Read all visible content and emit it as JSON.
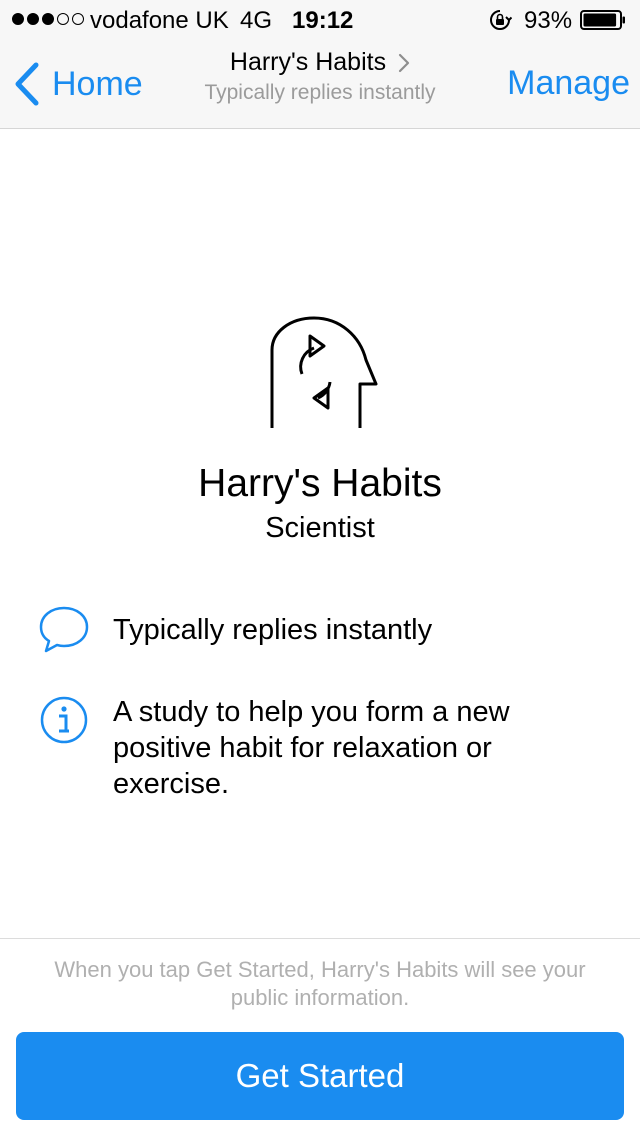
{
  "status_bar": {
    "signal_filled": 3,
    "signal_total": 5,
    "carrier": "vodafone UK",
    "network": "4G",
    "time": "19:12",
    "battery_percent": "93%",
    "battery_level": 0.93
  },
  "nav": {
    "back_label": "Home",
    "title": "Harry's Habits",
    "subtitle": "Typically replies instantly",
    "manage_label": "Manage"
  },
  "profile": {
    "icon": "head-refresh-icon",
    "name": "Harry's Habits",
    "role": "Scientist"
  },
  "info": {
    "replies": "Typically replies instantly",
    "about": "A study to help you form a new positive habit for relaxation or exercise."
  },
  "footer": {
    "disclaimer": "When you tap Get Started, Harry's Habits will see your public information.",
    "button_label": "Get Started"
  },
  "colors": {
    "accent": "#1a8cf0",
    "muted_text": "#9b9b9b",
    "nav_background": "#f7f7f7"
  }
}
